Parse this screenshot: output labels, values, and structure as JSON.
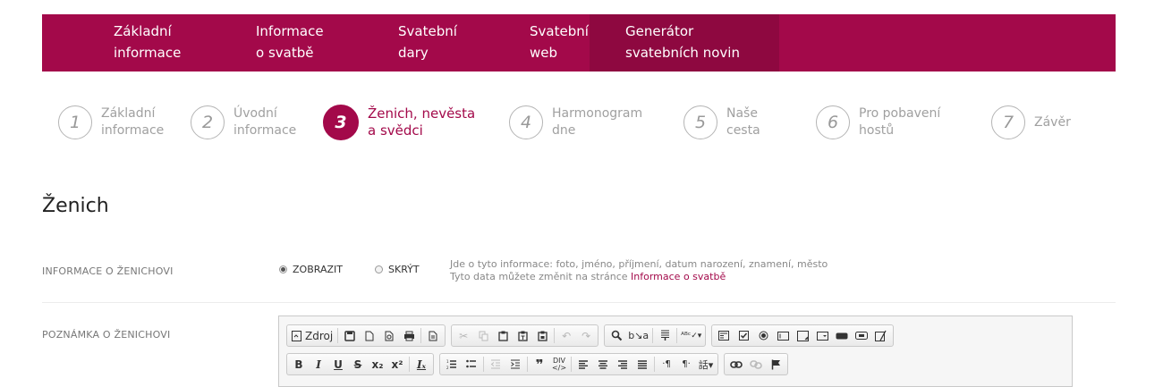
{
  "nav": [
    {
      "label": "Základní\ninformace",
      "active": false
    },
    {
      "label": "Informace\no svatbě",
      "active": false
    },
    {
      "label": "Svatební\ndary",
      "active": false
    },
    {
      "label": "Svatební\nweb",
      "active": false
    },
    {
      "label": "Generátor\nsvatebních novin",
      "active": true
    }
  ],
  "steps": [
    {
      "num": "1",
      "label": "Základní\ninformace"
    },
    {
      "num": "2",
      "label": "Úvodní\ninformace"
    },
    {
      "num": "3",
      "label": "Ženich, nevěsta\na svědci",
      "active": true
    },
    {
      "num": "4",
      "label": "Harmonogram\ndne"
    },
    {
      "num": "5",
      "label": "Naše\ncesta"
    },
    {
      "num": "6",
      "label": "Pro pobavení\nhostů"
    },
    {
      "num": "7",
      "label": "Závěr"
    }
  ],
  "section": {
    "title": "Ženich"
  },
  "groom_info": {
    "label": "INFORMACE O ŽENICHOVI",
    "show_label": "ZOBRAZIT",
    "hide_label": "SKRÝT",
    "selected": "show",
    "hint_line1": "Jde o tyto informace: foto, jméno, příjmení, datum narození, znamení, město",
    "hint_line2_prefix": "Tyto data můžete změnit na stránce ",
    "hint_link": "Informace o svatbě"
  },
  "groom_note": {
    "label": "POZNÁMKA O ŽENICHOVI"
  },
  "editor": {
    "source_label": "Zdroj",
    "colors": {
      "accent": "#a3094a"
    }
  }
}
